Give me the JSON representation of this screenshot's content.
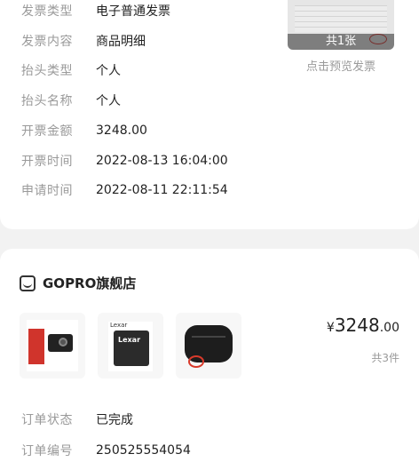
{
  "invoice": {
    "rows": [
      {
        "label": "发票类型",
        "value": "电子普通发票"
      },
      {
        "label": "发票内容",
        "value": "商品明细"
      },
      {
        "label": "抬头类型",
        "value": "个人"
      },
      {
        "label": "抬头名称",
        "value": "个人"
      },
      {
        "label": "开票金额",
        "value": "3248.00"
      },
      {
        "label": "开票时间",
        "value": "2022-08-13 16:04:00"
      },
      {
        "label": "申请时间",
        "value": "2022-08-11 22:11:54"
      }
    ],
    "preview": {
      "count": "共1张",
      "caption": "点击预览发票"
    }
  },
  "order": {
    "store_name": "GOPRO旗舰店",
    "price_currency": "¥",
    "price_integer": "3248",
    "price_decimal": ".00",
    "quantity": "共3件",
    "status_label": "订单状态",
    "status_value": "已完成",
    "number_label": "订单编号",
    "number_value": "250525554054",
    "thumb2_brand": "Lexar",
    "thumb2_card_text": "Lexar"
  }
}
